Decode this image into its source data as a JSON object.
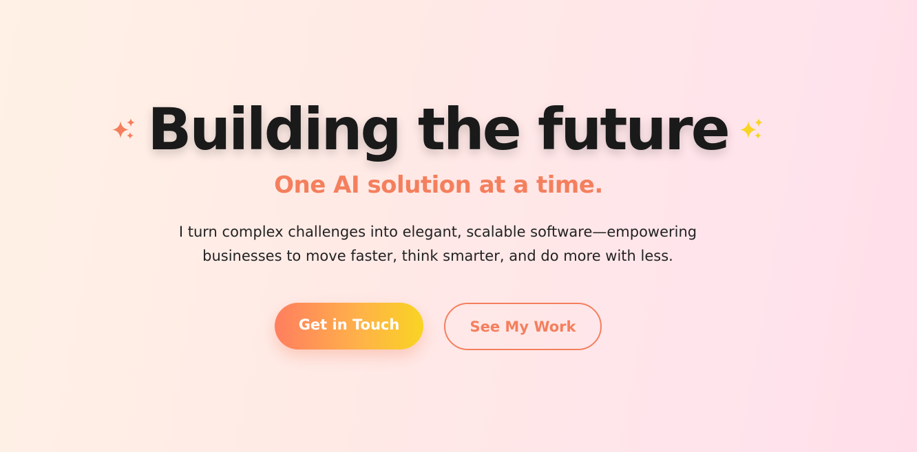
{
  "hero": {
    "headline": "Building the future",
    "subheadline": "One AI solution at a time.",
    "description_line1": "I turn complex challenges into elegant, scalable software—empowering",
    "description_line2": "businesses to move faster, think smarter, and do more with less.",
    "left_icon": "sparkles-icon",
    "right_icon": "sparkles-icon"
  },
  "buttons": {
    "primary_label": "Get in Touch",
    "secondary_label": "See My Work"
  },
  "colors": {
    "accent": "#f47f5d",
    "headline": "#1a1a1a",
    "sparkle_left": "#f47f5d",
    "sparkle_right": "#f9d423",
    "gradient_start": "#ff7e5f",
    "gradient_end": "#f9d423"
  }
}
